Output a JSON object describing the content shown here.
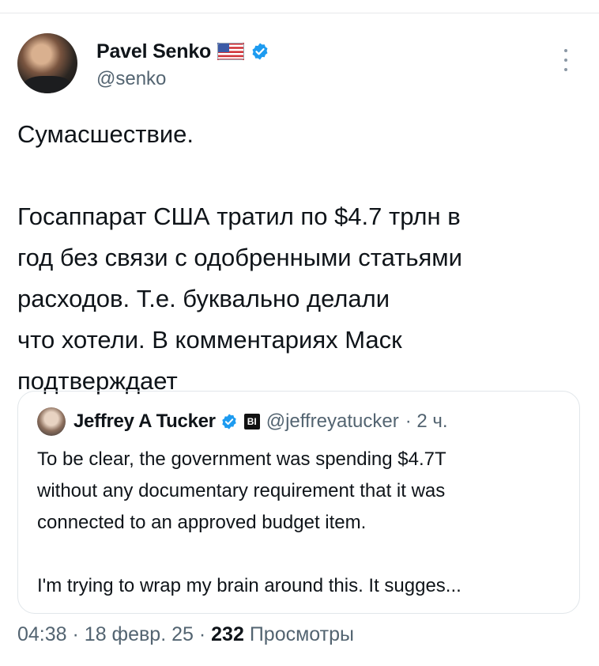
{
  "author": {
    "name": "Pavel Senko",
    "handle": "@senko"
  },
  "tweet": {
    "text": "Сумасшествие.\n\nГосаппарат США тратил по $4.7 трлн в\nгод без связи с одобренными статьями\nрасходов. Т.е. буквально делали\nчто хотели. В комментариях Маск\nподтверждает"
  },
  "quote": {
    "name": "Jeffrey A Tucker",
    "org_badge": "BI",
    "handle": "@jeffreyatucker",
    "time": "· 2 ч.",
    "text": "To be clear, the government was spending $4.7T\nwithout any documentary requirement that it was\nconnected to an approved budget item.\n\nI'm trying to wrap my brain around this. It sugges..."
  },
  "meta": {
    "time": "04:38",
    "date": "18 февр. 25",
    "views_count": "232",
    "views_label": "Просмотры",
    "separator": "·"
  },
  "colors": {
    "verified": "#1d9bf0",
    "secondary_text": "#536471",
    "border": "#e1e6ea"
  },
  "icons": [
    "us-flag-icon",
    "verified-badge-icon",
    "more-options-icon",
    "organization-badge-icon"
  ]
}
